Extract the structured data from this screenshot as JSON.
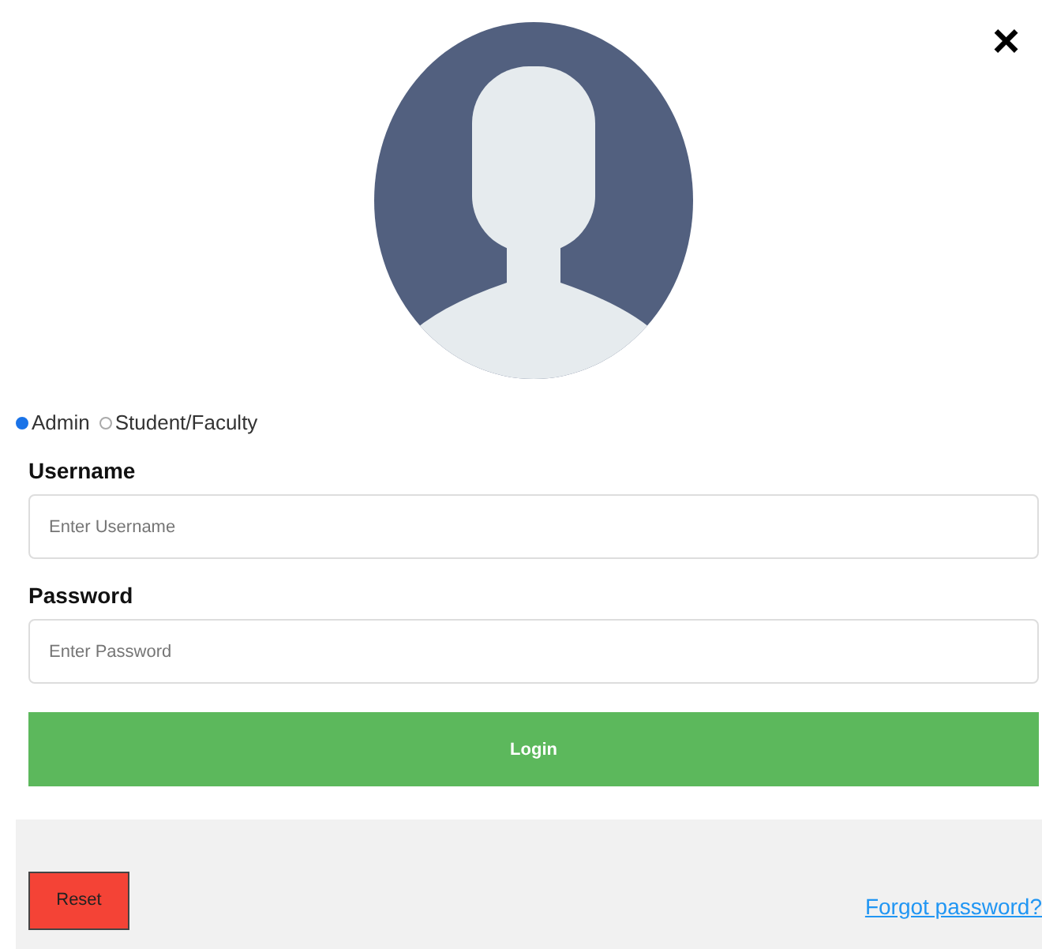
{
  "close": "×",
  "roles": [
    {
      "label": "Admin",
      "selected": true
    },
    {
      "label": "Student/Faculty",
      "selected": false
    }
  ],
  "fields": [
    {
      "label": "Username",
      "placeholder": "Enter Username"
    },
    {
      "label": "Password",
      "placeholder": "Enter Password"
    }
  ],
  "login_button": "Login",
  "footer": {
    "reset_button": "Reset",
    "forgot_link": "Forgot password?"
  }
}
